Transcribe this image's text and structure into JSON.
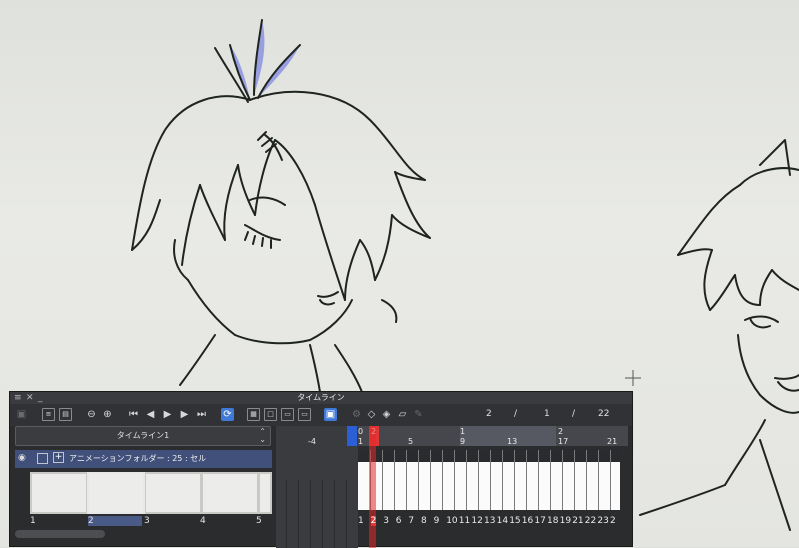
{
  "timeline": {
    "title": "タイムライン",
    "window_controls": [
      "≡",
      "✕",
      "_"
    ],
    "timeline_name": "タイムライン1",
    "frame_counter": {
      "a": "2",
      "sep1": "/",
      "b": "1",
      "sep2": "/",
      "c": "22"
    },
    "layer": {
      "name": "アニメーションフォルダー : 25 : セル"
    },
    "cell_numbers": [
      "1",
      "2",
      "3",
      "4",
      "5"
    ],
    "selected_cell": "2",
    "ruler_left_label": "-4",
    "ruler_top": [
      "0",
      "2",
      "1",
      "2"
    ],
    "ruler_bottom": [
      "1",
      "5",
      "9",
      "13",
      "17",
      "21"
    ],
    "frame_numbers": [
      "1",
      "2",
      "3",
      "6",
      "7",
      "8",
      "9",
      "10",
      "11",
      "12",
      "13",
      "14",
      "15",
      "16",
      "17",
      "18",
      "19",
      "21",
      "22",
      "23",
      "2"
    ],
    "colors": {
      "panel": "#2b2c2e",
      "accent": "#3f7ad8",
      "playhead": "#e03636",
      "marker": "#2b5fd6"
    }
  }
}
